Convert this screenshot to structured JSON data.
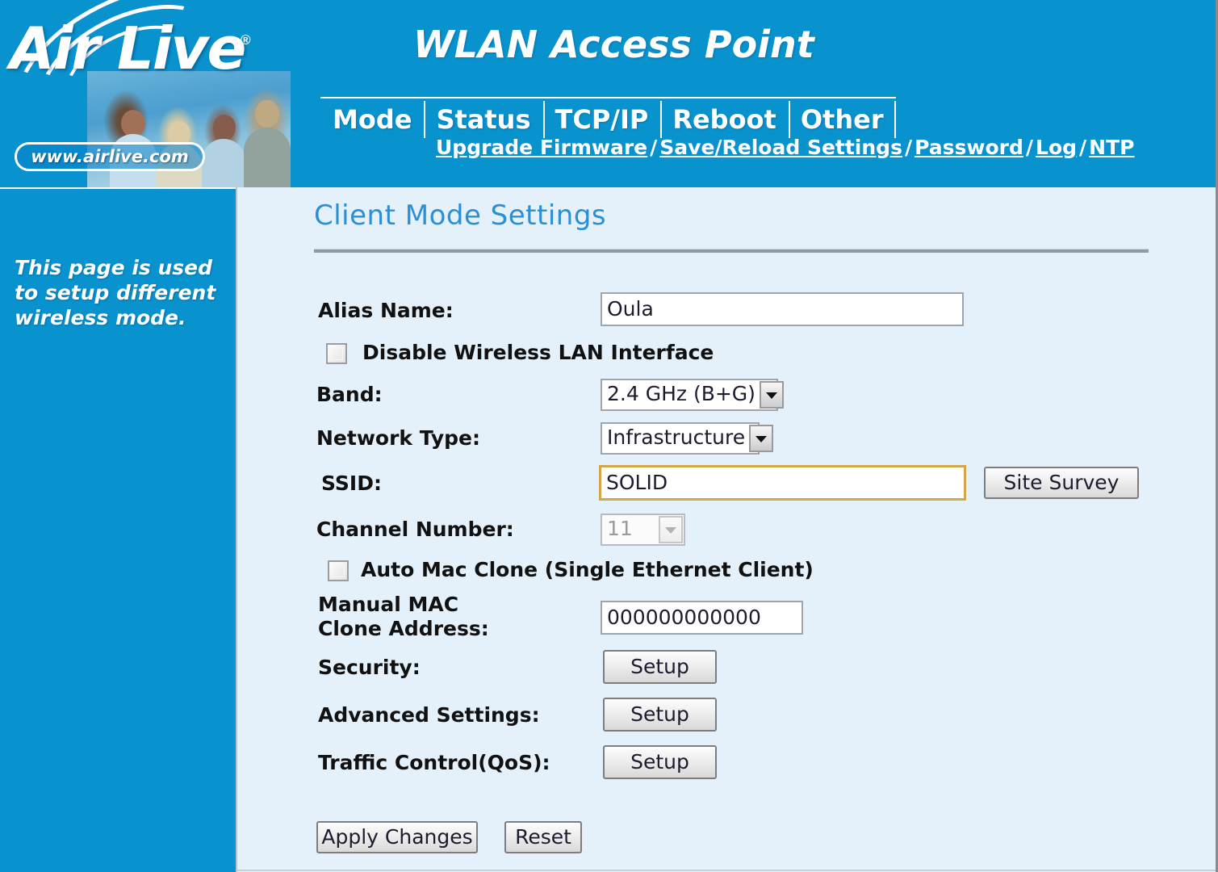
{
  "header": {
    "brand": "Air Live",
    "brand_registered": "®",
    "website": "www.airlive.com",
    "product_title": "WLAN Access Point",
    "tabs": [
      {
        "label": "Mode"
      },
      {
        "label": "Status"
      },
      {
        "label": "TCP/IP"
      },
      {
        "label": "Reboot"
      },
      {
        "label": "Other"
      }
    ],
    "subnav": [
      {
        "label": "Upgrade Firmware"
      },
      {
        "label": "Save/Reload Settings"
      },
      {
        "label": "Password"
      },
      {
        "label": "Log"
      },
      {
        "label": "NTP"
      }
    ],
    "subnav_separator": "/"
  },
  "sidebar": {
    "help_text": "This page is used to setup different wireless mode."
  },
  "main": {
    "page_title": "Client Mode Settings",
    "fields": {
      "alias_name": {
        "label": "Alias Name:",
        "value": "Oula"
      },
      "disable_wlan": {
        "label": "Disable Wireless LAN Interface",
        "checked": false
      },
      "band": {
        "label": "Band:",
        "value": "2.4 GHz (B+G)"
      },
      "network_type": {
        "label": "Network Type:",
        "value": "Infrastructure"
      },
      "ssid": {
        "label": "SSID:",
        "value": "SOLID",
        "focused": true
      },
      "site_survey": {
        "label": "Site Survey"
      },
      "channel_number": {
        "label": "Channel Number:",
        "value": "11",
        "disabled": true
      },
      "auto_mac_clone": {
        "label": "Auto Mac Clone (Single Ethernet Client)",
        "checked": false
      },
      "manual_mac": {
        "label": "Manual MAC Clone Address:",
        "value": "000000000000"
      },
      "security": {
        "label": "Security:",
        "button": "Setup"
      },
      "advanced_settings": {
        "label": "Advanced Settings:",
        "button": "Setup"
      },
      "traffic_control": {
        "label": "Traffic Control(QoS):",
        "button": "Setup"
      }
    },
    "actions": {
      "apply": "Apply Changes",
      "reset": "Reset"
    }
  },
  "colors": {
    "header_blue": "#0892ce",
    "content_bg": "#e4f1fb",
    "title_blue": "#2b8fd4",
    "focus_border": "#d3a64a"
  }
}
